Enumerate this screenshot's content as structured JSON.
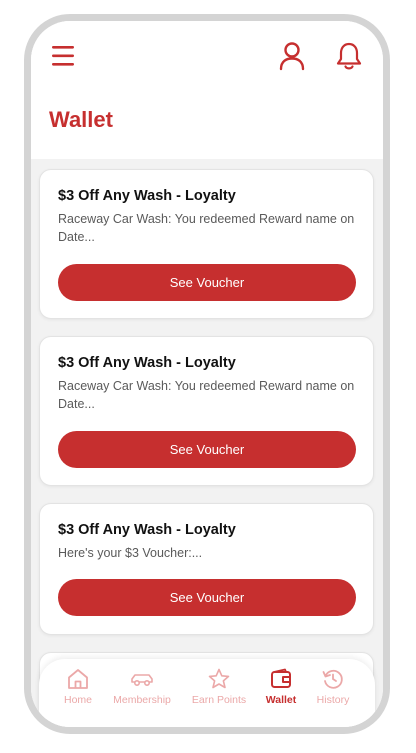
{
  "header": {
    "title": "Wallet",
    "menu_icon": "hamburger-menu-icon",
    "profile_icon": "user-icon",
    "notification_icon": "bell-icon"
  },
  "colors": {
    "brand": "#c62f2f",
    "tab_inactive": "#eba8a8",
    "background": "#f2f2f2"
  },
  "vouchers": [
    {
      "title": "$3 Off Any Wash - Loyalty",
      "description": "Raceway Car Wash: You redeemed Reward name on Date...",
      "button_label": "See Voucher"
    },
    {
      "title": "$3 Off Any Wash - Loyalty",
      "description": "Raceway Car Wash: You redeemed Reward name on Date...",
      "button_label": "See Voucher"
    },
    {
      "title": "$3 Off Any Wash - Loyalty",
      "description": "Here's your $3 Voucher:...",
      "button_label": "See Voucher"
    }
  ],
  "tabbar": {
    "active": "Wallet",
    "items": [
      {
        "label": "Home",
        "icon": "home-icon"
      },
      {
        "label": "Membership",
        "icon": "car-icon"
      },
      {
        "label": "Earn Points",
        "icon": "star-icon"
      },
      {
        "label": "Wallet",
        "icon": "wallet-icon"
      },
      {
        "label": "History",
        "icon": "history-icon"
      }
    ]
  }
}
